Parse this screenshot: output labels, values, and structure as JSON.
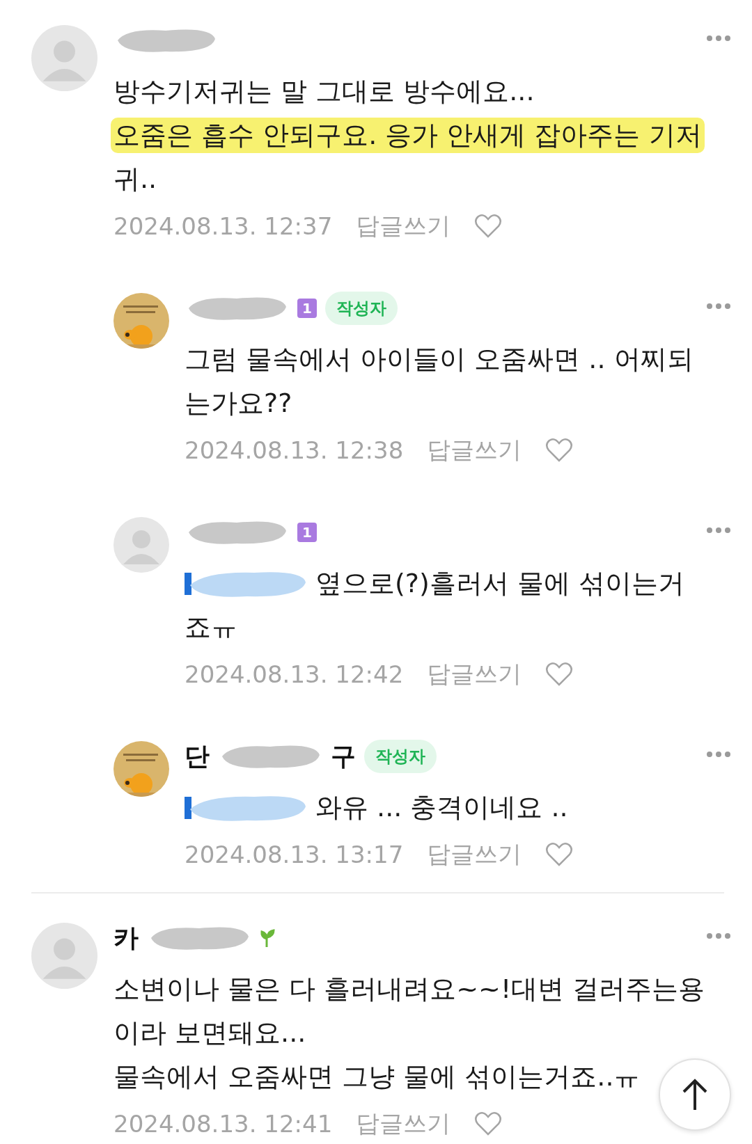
{
  "comments": [
    {
      "reply": false,
      "avatar": {
        "kind": "default"
      },
      "lines": [
        {
          "text": "방수기저귀는 말 그대로 방수에요...",
          "highlighted": false,
          "mention": false
        },
        {
          "text": "오줌은 흡수 안되구요. 응가 안새게 잡아주는 기저",
          "highlighted": true,
          "mention": false
        },
        {
          "text": "귀..",
          "highlighted": false,
          "mention": false
        }
      ],
      "date": "2024.08.13. 12:37",
      "reply_label": "답글쓰기",
      "divider_before": false
    },
    {
      "reply": true,
      "avatar": {
        "kind": "picture"
      },
      "badges": [
        {
          "kind": "level",
          "text": "1"
        },
        {
          "kind": "author",
          "text": "작성자"
        }
      ],
      "lines": [
        {
          "text": "그럼 물속에서 아이들이 오줌싸면 .. 어찌되",
          "highlighted": false,
          "mention": false
        },
        {
          "text": "는가요??",
          "highlighted": false,
          "mention": false
        }
      ],
      "date": "2024.08.13. 12:38",
      "reply_label": "답글쓰기",
      "divider_before": false
    },
    {
      "reply": true,
      "avatar": {
        "kind": "default"
      },
      "badges": [
        {
          "kind": "level",
          "text": "1"
        }
      ],
      "lines": [
        {
          "text": "옆으로(?)흘러서 물에 섞이는거",
          "highlighted": false,
          "mention": true
        },
        {
          "text": "죠ㅠ",
          "highlighted": false,
          "mention": false
        }
      ],
      "date": "2024.08.13. 12:42",
      "reply_label": "답글쓰기",
      "divider_before": false
    },
    {
      "reply": true,
      "avatar": {
        "kind": "picture"
      },
      "name_start": "단",
      "name_end": "구",
      "badges": [
        {
          "kind": "author",
          "text": "작성자"
        }
      ],
      "lines": [
        {
          "text": "와유 ... 충격이네요 ..",
          "highlighted": false,
          "mention": true
        }
      ],
      "date": "2024.08.13. 13:17",
      "reply_label": "답글쓰기",
      "divider_before": false
    },
    {
      "reply": false,
      "avatar": {
        "kind": "default"
      },
      "name_start": "카",
      "badges": [
        {
          "kind": "sprout"
        }
      ],
      "lines": [
        {
          "text": "소변이나 물은 다 흘러내려요~~!대변 걸러주는용",
          "highlighted": false,
          "mention": false
        },
        {
          "text": "이라 보면돼요...",
          "highlighted": false,
          "mention": false
        },
        {
          "text": "물속에서 오줌싸면 그냥 물에 섞이는거죠..ㅠ",
          "highlighted": false,
          "mention": false
        }
      ],
      "date": "2024.08.13. 12:41",
      "reply_label": "답글쓰기",
      "divider_before": true
    }
  ]
}
